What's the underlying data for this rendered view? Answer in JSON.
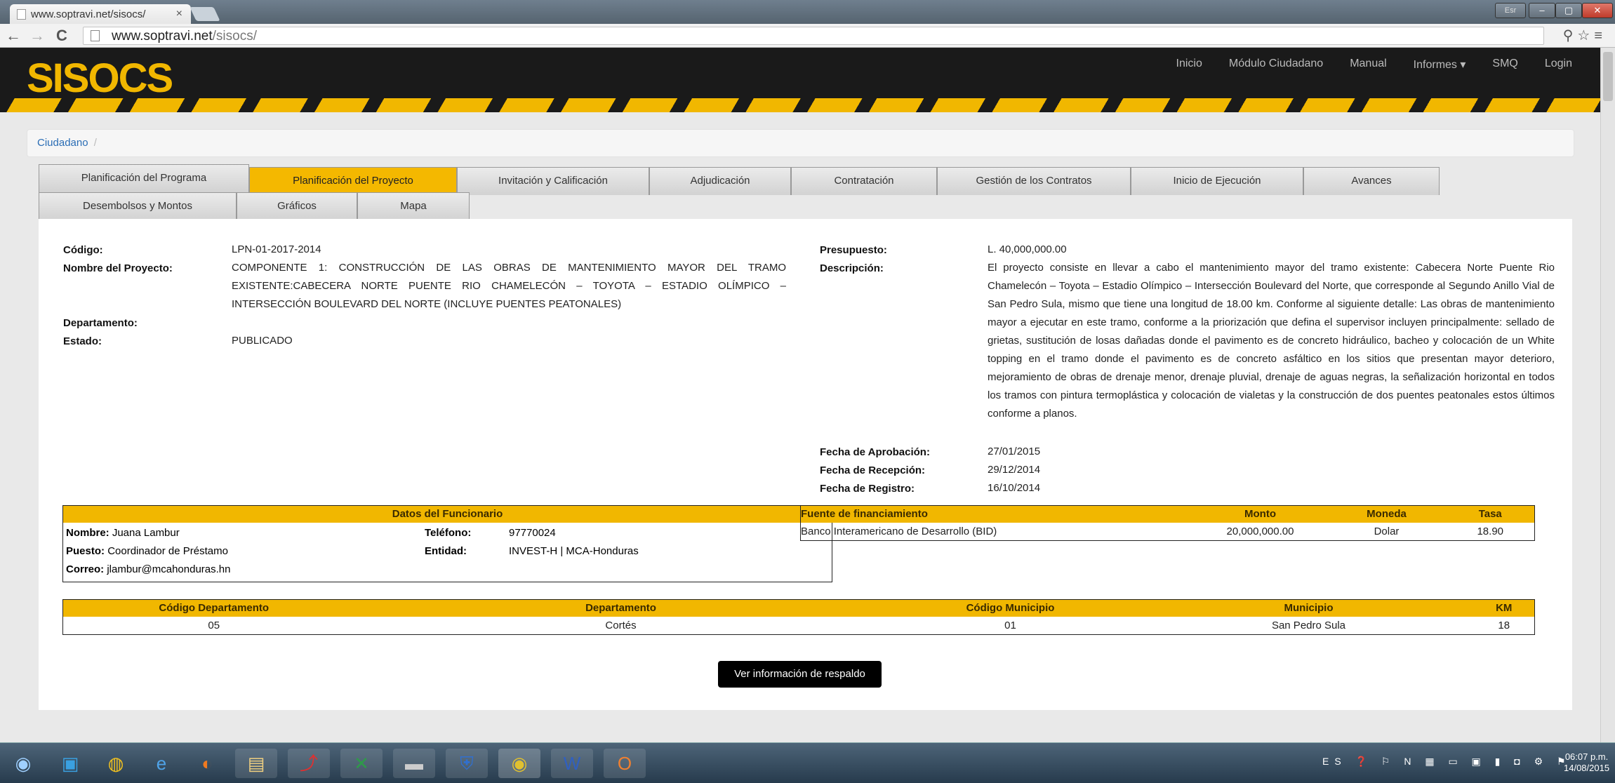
{
  "browser": {
    "tab_title": "www.soptravi.net/sisocs/",
    "tab_close": "×",
    "lang": "Esr",
    "window_buttons": [
      "–",
      "▢",
      "✕"
    ],
    "url_host": "www.soptravi.net",
    "url_path": "/sisocs/",
    "nav": [
      "←",
      "→",
      "C"
    ]
  },
  "site": {
    "logo": "SISOCS",
    "nav": [
      "Inicio",
      "Módulo Ciudadano",
      "Manual",
      "Informes ▾",
      "SMQ",
      "Login"
    ]
  },
  "breadcrumb": {
    "label": "Ciudadano",
    "sep": "/"
  },
  "tabs_row1": [
    "Planificación del Programa",
    "Planificación del Proyecto",
    "Invitación y Calificación",
    "Adjudicación",
    "Contratación",
    "Gestión de los Contratos",
    "Inicio de Ejecución",
    "Avances"
  ],
  "tabs_row2": [
    "Desembolsos y Montos",
    "Gráficos",
    "Mapa"
  ],
  "active_tab": "Planificación del Proyecto",
  "project": {
    "codigo_label": "Código:",
    "codigo": "LPN-01-2017-2014",
    "nombre_label": "Nombre del Proyecto:",
    "nombre": "COMPONENTE 1: CONSTRUCCIÓN DE LAS OBRAS DE MANTENIMIENTO MAYOR DEL TRAMO EXISTENTE:CABECERA NORTE PUENTE RIO CHAMELECÓN – TOYOTA – ESTADIO OLÍMPICO – INTERSECCIÓN BOULEVARD DEL NORTE (INCLUYE PUENTES PEATONALES)",
    "departamento_label": "Departamento:",
    "estado_label": "Estado:",
    "estado": "PUBLICADO",
    "presupuesto_label": "Presupuesto:",
    "presupuesto": "L. 40,000,000.00",
    "descripcion_label": "Descripción:",
    "descripcion": "El proyecto consiste en llevar a cabo el mantenimiento mayor del tramo existente: Cabecera Norte Puente Rio Chamelecón – Toyota – Estadio Olímpico – Intersección Boulevard del Norte, que corresponde al Segundo Anillo Vial de San Pedro Sula, mismo que tiene una longitud de 18.00 km. Conforme al siguiente detalle: Las obras de mantenimiento mayor a ejecutar en este tramo, conforme a la priorización que defina el supervisor incluyen principalmente: sellado de grietas, sustitución de losas dañadas donde el pavimento es de concreto hidráulico, bacheo y colocación de un White topping en el tramo donde el pavimento es de concreto asfáltico en los sitios que presentan mayor deterioro, mejoramiento de obras de drenaje menor, drenaje pluvial, drenaje de aguas negras, la señalización horizontal en todos los tramos con pintura termoplástica y colocación de vialetas y la construcción de dos puentes peatonales estos últimos conforme a planos.",
    "aprobacion_label": "Fecha de Aprobación:",
    "aprobacion": "27/01/2015",
    "recepcion_label": "Fecha de Recepción:",
    "recepcion": "29/12/2014",
    "registro_label": "Fecha de Registro:",
    "registro": "16/10/2014"
  },
  "funcionario": {
    "title": "Datos del Funcionario",
    "nombre_label": "Nombre:",
    "nombre": "Juana Lambur",
    "puesto_label": "Puesto:",
    "puesto": "Coordinador de Préstamo",
    "correo_label": "Correo:",
    "correo": "jlambur@mcahonduras.hn",
    "telefono_label": "Teléfono:",
    "telefono": "97770024",
    "entidad_label": "Entidad:",
    "entidad": "INVEST-H | MCA-Honduras"
  },
  "fuente": {
    "headers": [
      "Fuente de financiamiento",
      "Monto",
      "Moneda",
      "Tasa"
    ],
    "row": [
      "Banco Interamericano de Desarrollo (BID)",
      "20,000,000.00",
      "Dolar",
      "18.90"
    ]
  },
  "departamentos": {
    "headers": [
      "Código Departamento",
      "Departamento",
      "Código Municipio",
      "Municipio",
      "KM"
    ],
    "row": [
      "05",
      "Cortés",
      "01",
      "San Pedro Sula",
      "18"
    ]
  },
  "respaldo_button": "Ver información de respaldo",
  "taskbar": {
    "tray": "ES ❓ ⚐ N ▦ ▭ ▣ ▮ ◘ ⚙ ⚑",
    "time": "06:07 p.m.",
    "date": "14/08/2015"
  }
}
